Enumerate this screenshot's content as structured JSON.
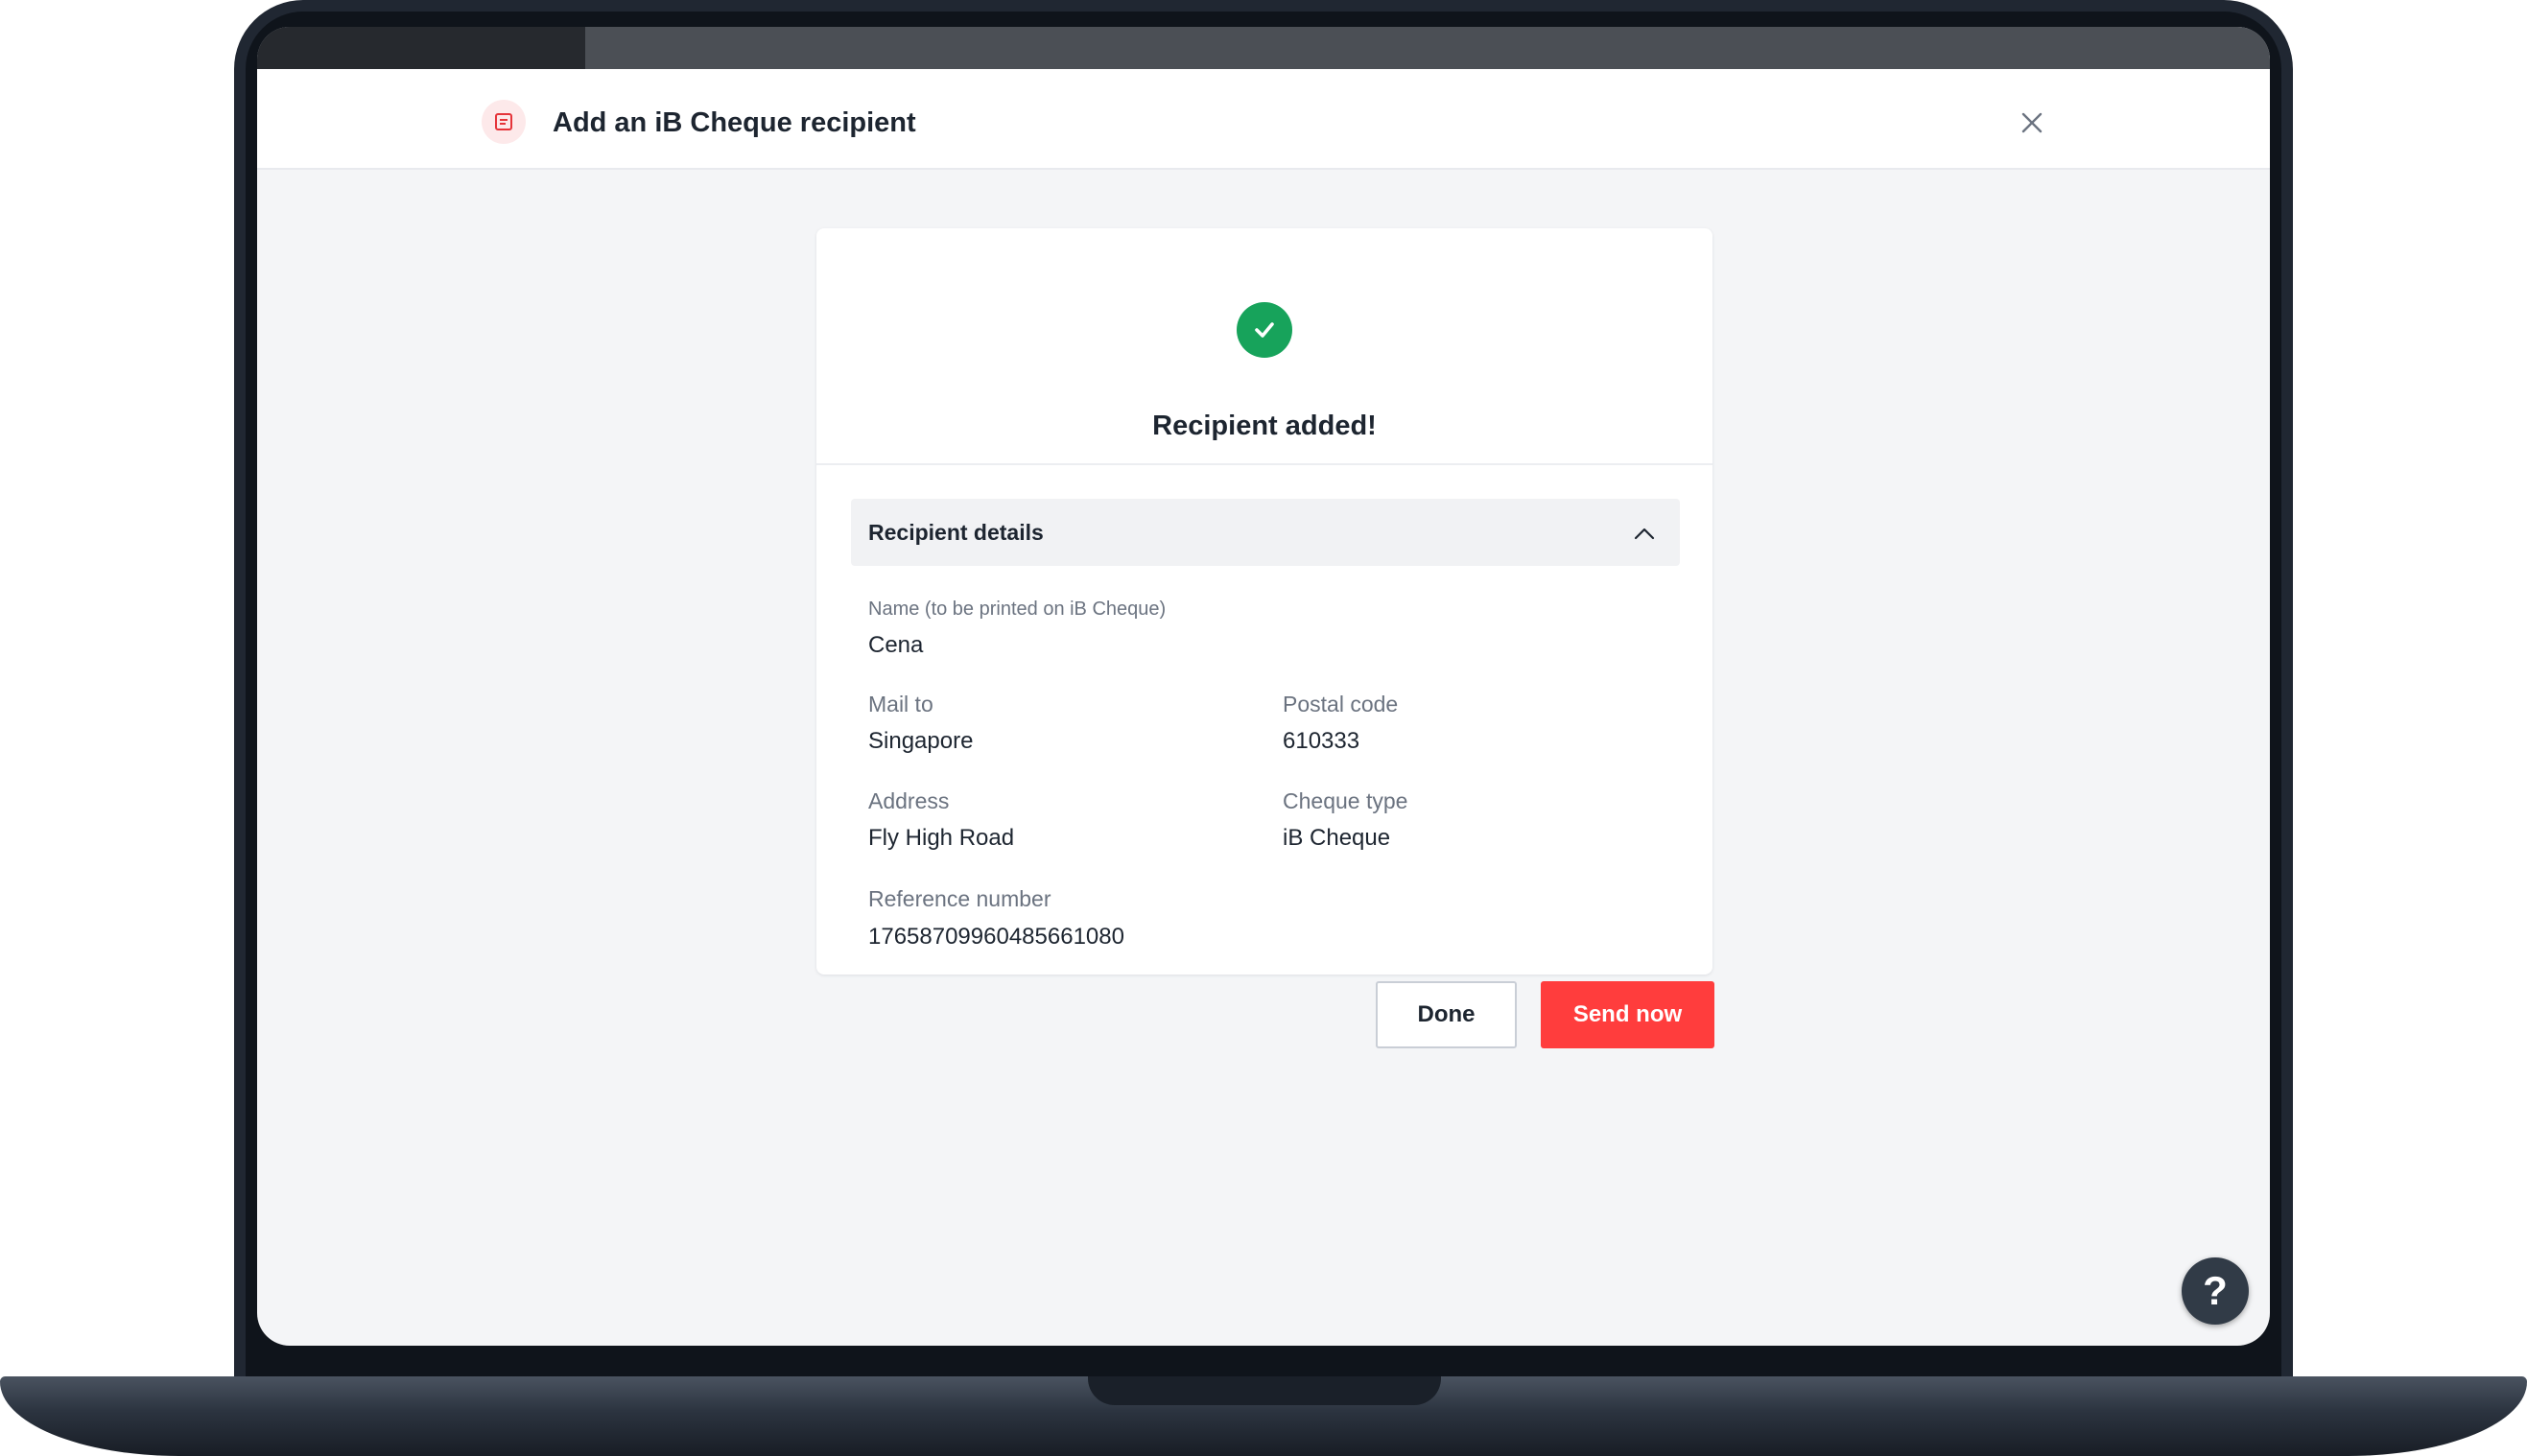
{
  "modal": {
    "title": "Add an iB Cheque recipient"
  },
  "result": {
    "title": "Recipient added!"
  },
  "details": {
    "section_title": "Recipient details",
    "name_label": "Name (to be printed on iB Cheque)",
    "name_value": "Cena",
    "mail_to_label": "Mail to",
    "mail_to_value": "Singapore",
    "postal_code_label": "Postal code",
    "postal_code_value": "610333",
    "address_label": "Address",
    "address_value": "Fly High Road",
    "cheque_type_label": "Cheque type",
    "cheque_type_value": "iB Cheque",
    "reference_label": "Reference number",
    "reference_value": "17658709960485661080"
  },
  "actions": {
    "done_label": "Done",
    "send_label": "Send now"
  },
  "help": {
    "label": "?"
  },
  "icons": {
    "header": "cheque-icon",
    "close": "close-icon",
    "success": "check-circle-icon",
    "chevron": "chevron-up-icon",
    "help": "help-icon"
  },
  "colors": {
    "success": "#17a35b",
    "primary_button": "#ff3d3d",
    "header_icon": "#e5343a",
    "help_button": "#313b47"
  }
}
